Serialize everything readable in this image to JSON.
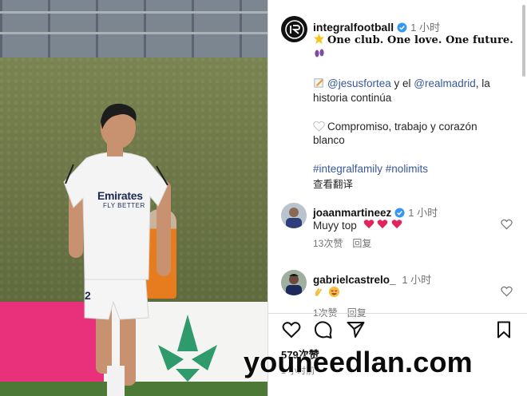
{
  "post": {
    "username": "integralfootball",
    "time": "1 小时",
    "caption": {
      "motto": "One club. One love. One future.",
      "mention_1": "@jesusfortea",
      "connector": " y el ",
      "mention_2": "@realmadrid",
      "line_2_tail": ", la",
      "line_3": "historia continúa",
      "line_4": "Compromiso, trabajo y corazón",
      "line_5": "blanco",
      "hashtags": "#integralfamily #nolimits",
      "translate": "查看翻译"
    }
  },
  "comments": [
    {
      "username": "joaanmartineez",
      "time": "1 小时",
      "text": "Muyy top",
      "likes": "13次赞",
      "reply": "回复"
    },
    {
      "username": "gabrielcastrelo_",
      "time": "1 小时",
      "text": "",
      "likes": "1次赞",
      "reply": "回复"
    }
  ],
  "actions": {
    "like_count": "579次赞",
    "posted_ago": "1 小时前"
  },
  "photo": {
    "shirt_sponsor_1": "Emirates",
    "shirt_sponsor_2": "FLY BETTER",
    "shorts_number": "2"
  },
  "watermark": "youneedlan.com",
  "colors": {
    "link": "#385898",
    "verified": "#3897f0",
    "heart_emoji": "#e0245e",
    "pink_board": "#e8317a"
  },
  "icons": [
    "verified-badge-icon",
    "star-emoji-icon",
    "footprints-emoji-icon",
    "pencil-emoji-icon",
    "white-heart-emoji-icon",
    "red-heart-emoji-icon",
    "clap-emoji-icon",
    "heart-eyes-emoji-icon",
    "heart-outline-icon",
    "comment-icon",
    "share-icon",
    "bookmark-icon"
  ]
}
